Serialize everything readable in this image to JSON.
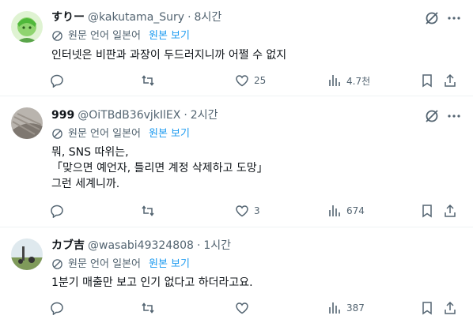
{
  "translate": {
    "label": "원문 언어 일본어",
    "show": "원본 보기"
  },
  "tweets": [
    {
      "name": "すりー",
      "handle": "@kakutama_Sury",
      "time": "8시간",
      "lines": [
        "인터넷은 비판과 과장이 두드러지니까 어쩔 수 없지"
      ],
      "replies": "",
      "retweets": "",
      "likes": "25",
      "views": "4.7천"
    },
    {
      "name": "999",
      "handle": "@OiTBdB36vjkIlEX",
      "time": "2시간",
      "lines": [
        "뭐, SNS 따위는,",
        "「맞으면 예언자, 틀리면 계정 삭제하고 도망」",
        "그런 세계니까."
      ],
      "replies": "",
      "retweets": "",
      "likes": "3",
      "views": "674"
    },
    {
      "name": "カブ吉",
      "handle": "@wasabi49324808",
      "time": "1시간",
      "lines": [
        "1분기 매출만 보고 인기 없다고 하더라고요."
      ],
      "replies": "",
      "retweets": "",
      "likes": "",
      "views": "387"
    }
  ],
  "colors": {
    "secondary": "#536471",
    "link": "#1d9bf0",
    "divider": "#eff3f4"
  }
}
